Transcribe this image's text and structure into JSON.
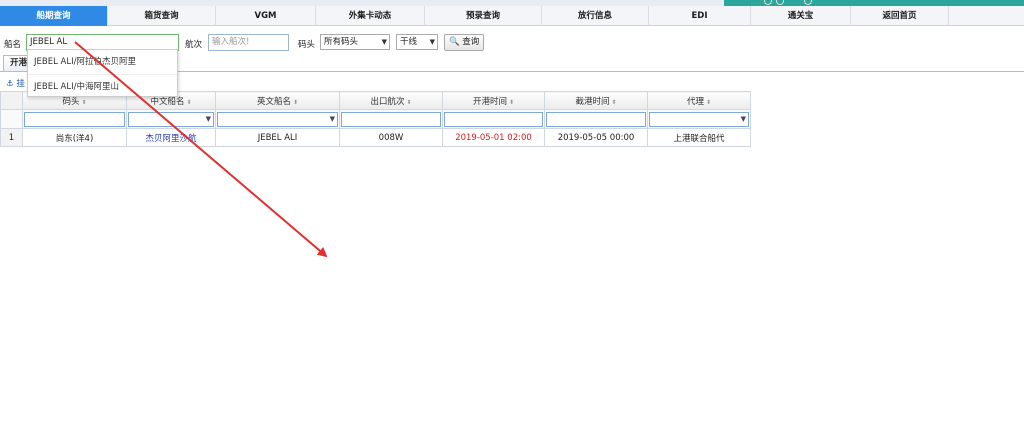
{
  "nav": {
    "tabs": [
      {
        "label": "船期查询",
        "active": true
      },
      {
        "label": "箱货查询",
        "active": false
      },
      {
        "label": "VGM",
        "active": false
      },
      {
        "label": "外集卡动态",
        "active": false
      },
      {
        "label": "预录查询",
        "active": false
      },
      {
        "label": "放行信息",
        "active": false
      },
      {
        "label": "EDI",
        "active": false
      },
      {
        "label": "通关宝",
        "active": false
      },
      {
        "label": "返回首页",
        "active": false
      }
    ]
  },
  "filter": {
    "ship_label": "船名",
    "ship_value": "JEBEL AL",
    "voyage_label": "航次",
    "voyage_placeholder": "输入船次!",
    "terminal_label": "码头",
    "terminal_value": "所有码头",
    "line_value": "干线",
    "search_label": "查询"
  },
  "autocomplete": {
    "items": [
      "JEBEL ALI/阿拉伯杰贝阿里",
      "JEBEL ALI/中海阿里山"
    ]
  },
  "subtab": {
    "label": "开港"
  },
  "toolbar": {
    "label": "挂"
  },
  "table": {
    "columns": [
      "码头",
      "中文船名",
      "英文船名",
      "出口航次",
      "开港时间",
      "截港时间",
      "代理"
    ],
    "rows": [
      {
        "num": "1",
        "terminal": "尚东(洋4)",
        "cn_name": "杰贝阿里沙航",
        "en_name": "JEBEL ALI",
        "voyage": "008W",
        "open_time": "2019-05-01 02:00",
        "close_time": "2019-05-05 00:00",
        "agent": "上港联合船代"
      }
    ]
  },
  "colors": {
    "nav_active": "#2f8ae5",
    "annotation_arrow": "#e03030",
    "open_time": "#d41c1c",
    "cn_name": "#2236b8"
  }
}
